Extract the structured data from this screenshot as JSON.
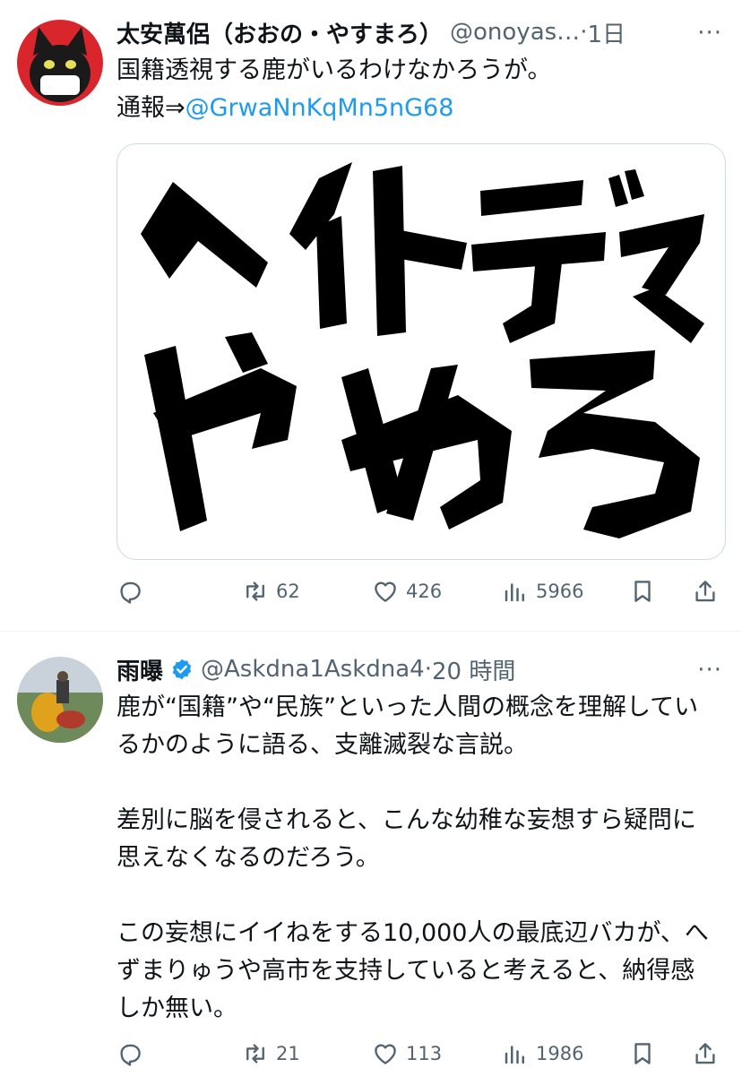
{
  "tweets": [
    {
      "display_name": "太安萬侶（おおの・やすまろ）",
      "handle": "@onoyas…",
      "separator": "·",
      "time": "1日",
      "more": "···",
      "text_main": "国籍透視する鹿がいるわけなかろうが。\n通報⇒",
      "mention": "@GrwaNnKqMn5nG68",
      "image_text": "ヘイトデマやめろ",
      "stats": {
        "replies": "",
        "retweets": "62",
        "likes": "426",
        "views": "5966"
      }
    },
    {
      "display_name": "雨曝",
      "handle": "@Askdna1Askdna4",
      "separator": "·",
      "time": "20 時間",
      "more": "···",
      "verified": true,
      "text_main": "鹿が“国籍”や“民族”といった人間の概念を理解しているかのように語る、支離滅裂な言説。\n\n差別に脳を侵されると、こんな幼稚な妄想すら疑問に思えなくなるのだろう。\n\nこの妄想にイイねをする10,000人の最底辺バカが、へずまりゅうや高市を支持していると考えると、納得感しか無い。",
      "stats": {
        "replies": "",
        "retweets": "21",
        "likes": "113",
        "views": "1986"
      }
    }
  ],
  "colors": {
    "text": "#0f1419",
    "secondary": "#536471",
    "link": "#1d9bf0",
    "verified": "#1d9bf0",
    "avatar1_bg": "#d9262c"
  },
  "icons": [
    "reply-icon",
    "retweet-icon",
    "like-icon",
    "views-icon",
    "bookmark-icon",
    "share-icon",
    "verified-badge-icon",
    "more-icon"
  ]
}
